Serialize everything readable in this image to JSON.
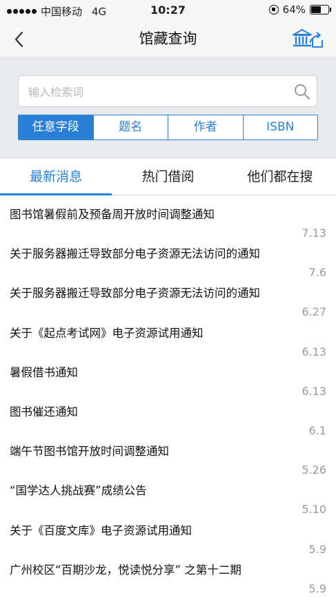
{
  "status_bar": {
    "carrier": "中国移动",
    "network": "4G",
    "time": "10:27",
    "battery": "64%",
    "battery_level": 0.64
  },
  "nav": {
    "title": "馆藏查询"
  },
  "search": {
    "placeholder": "输入检索词",
    "value": ""
  },
  "search_fields": [
    {
      "label": "任意字段",
      "active": true
    },
    {
      "label": "题名",
      "active": false
    },
    {
      "label": "作者",
      "active": false
    },
    {
      "label": "ISBN",
      "active": false
    }
  ],
  "tabs": [
    {
      "label": "最新消息",
      "active": true
    },
    {
      "label": "热门借阅",
      "active": false
    },
    {
      "label": "他们都在搜",
      "active": false
    }
  ],
  "news": [
    {
      "title": "图书馆暑假前及预备周开放时间调整通知",
      "date": "7.13"
    },
    {
      "title": "关于服务器搬迁导致部分电子资源无法访问的通知",
      "date": "7.6"
    },
    {
      "title": "关于服务器搬迁导致部分电子资源无法访问的通知",
      "date": "6.27"
    },
    {
      "title": "关于《起点考试网》电子资源试用通知",
      "date": "6.13"
    },
    {
      "title": "暑假借书通知",
      "date": "6.13"
    },
    {
      "title": "图书催还通知",
      "date": "6.1"
    },
    {
      "title": "端午节图书馆开放时间调整通知",
      "date": "5.26"
    },
    {
      "title": "“国学达人挑战赛”成绩公告",
      "date": "5.10"
    },
    {
      "title": "关于《百度文库》电子资源试用通知",
      "date": "5.9"
    },
    {
      "title": "广州校区“百期沙龙，悦读悦分享” 之第十二期",
      "date": "5.9"
    }
  ],
  "colors": {
    "accent": "#2a7fd6",
    "search_bg": "#e9eaee",
    "date_text": "#9a9a9a"
  }
}
